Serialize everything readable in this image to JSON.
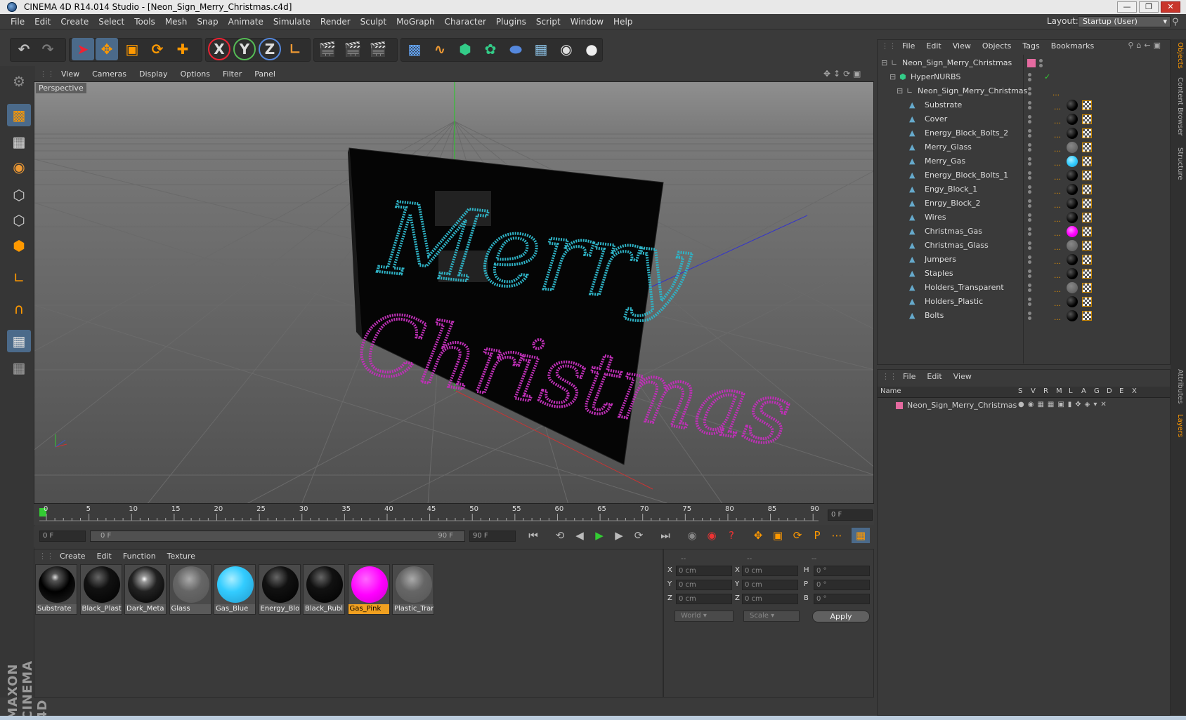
{
  "window": {
    "title": "CINEMA 4D R14.014 Studio - [Neon_Sign_Merry_Christmas.c4d]"
  },
  "menu": [
    "File",
    "Edit",
    "Create",
    "Select",
    "Tools",
    "Mesh",
    "Snap",
    "Animate",
    "Simulate",
    "Render",
    "Sculpt",
    "MoGraph",
    "Character",
    "Plugins",
    "Script",
    "Window",
    "Help"
  ],
  "layout": {
    "label": "Layout:",
    "value": "Startup (User)"
  },
  "viewport": {
    "menu": [
      "View",
      "Cameras",
      "Display",
      "Options",
      "Filter",
      "Panel"
    ],
    "label": "Perspective",
    "sign_word_1": "Merry",
    "sign_word_2": "Christmas",
    "colors": {
      "merry": "#2fb3c6",
      "christmas": "#c030b8"
    }
  },
  "timeline": {
    "ticks": [
      "0",
      "5",
      "10",
      "15",
      "20",
      "25",
      "30",
      "35",
      "40",
      "45",
      "50",
      "55",
      "60",
      "65",
      "70",
      "75",
      "80",
      "85",
      "90"
    ],
    "frame_field": "0 F",
    "start": "0 F",
    "range_start": "0 F",
    "range_end": "90 F",
    "end": "90 F"
  },
  "materials": {
    "menu": [
      "Create",
      "Edit",
      "Function",
      "Texture"
    ],
    "items": [
      {
        "name": "Substrate",
        "kind": "black-reflect"
      },
      {
        "name": "Black_Plast",
        "kind": "black"
      },
      {
        "name": "Dark_Meta",
        "kind": "metal"
      },
      {
        "name": "Glass",
        "kind": "glass"
      },
      {
        "name": "Gas_Blue",
        "kind": "blue"
      },
      {
        "name": "Energy_Blo",
        "kind": "black"
      },
      {
        "name": "Black_Rubl",
        "kind": "black"
      },
      {
        "name": "Gas_Pink",
        "kind": "pink"
      },
      {
        "name": "Plastic_Trar",
        "kind": "glass"
      }
    ]
  },
  "coords": {
    "headers": [
      "--",
      "--",
      "--"
    ],
    "rows": [
      {
        "a": "X",
        "av": "0 cm",
        "b": "X",
        "bv": "0 cm",
        "c": "H",
        "cv": "0 °"
      },
      {
        "a": "Y",
        "av": "0 cm",
        "b": "Y",
        "bv": "0 cm",
        "c": "P",
        "cv": "0 °"
      },
      {
        "a": "Z",
        "av": "0 cm",
        "b": "Z",
        "bv": "0 cm",
        "c": "B",
        "cv": "0 °"
      }
    ],
    "space": "World",
    "mode": "Scale",
    "apply": "Apply"
  },
  "objects": {
    "menu": [
      "File",
      "Edit",
      "View",
      "Objects",
      "Tags",
      "Bookmarks"
    ],
    "root": "Neon_Sign_Merry_Christmas",
    "hypernurbs": "HyperNURBS",
    "child": "Neon_Sign_Merry_Christmas",
    "items": [
      "Substrate",
      "Cover",
      "Energy_Block_Bolts_2",
      "Merry_Glass",
      "Merry_Gas",
      "Energy_Block_Bolts_1",
      "Engy_Block_1",
      "Enrgy_Block_2",
      "Wires",
      "Christmas_Gas",
      "Christmas_Glass",
      "Jumpers",
      "Staples",
      "Holders_Transparent",
      "Holders_Plastic",
      "Bolts"
    ]
  },
  "layers": {
    "menu": [
      "File",
      "Edit",
      "View"
    ],
    "columns": [
      "Name",
      "S",
      "V",
      "R",
      "M",
      "L",
      "A",
      "G",
      "D",
      "E",
      "X"
    ],
    "row": "Neon_Sign_Merry_Christmas"
  },
  "side_tabs": [
    "Objects",
    "Content Browser",
    "Structure",
    "Attributes",
    "Layers"
  ],
  "brand": "MAXON CINEMA 4D"
}
